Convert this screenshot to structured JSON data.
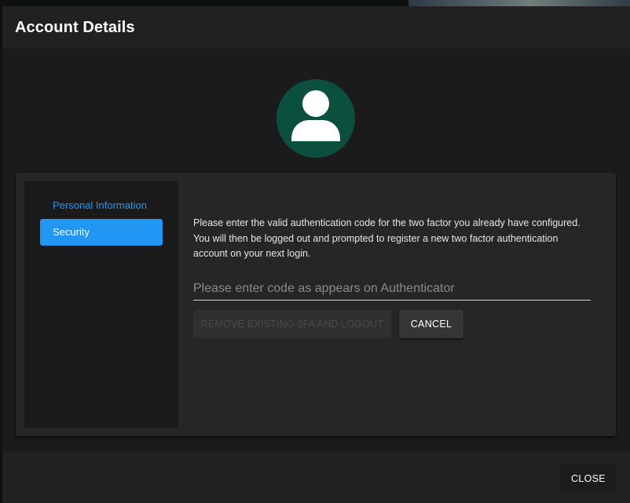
{
  "dialog": {
    "title": "Account Details"
  },
  "avatar": {
    "icon": "person-icon",
    "bg_color": "#0b4f3f"
  },
  "sidebar": {
    "items": [
      {
        "label": "Personal Information",
        "active": false
      },
      {
        "label": "Security",
        "active": true
      }
    ]
  },
  "security": {
    "description": "Please enter the valid authentication code for the two factor you already have configured. You will then be logged out and prompted to register a new two factor authentication account on your next login.",
    "code_placeholder": "Please enter code as appears on Authenticator",
    "code_value": "",
    "remove_label": "REMOVE EXISTING 2FA AND LOGOUT",
    "cancel_label": "CANCEL"
  },
  "actions": {
    "close_label": "CLOSE"
  },
  "colors": {
    "accent": "#2196f3",
    "dialog_bg": "#212121"
  }
}
